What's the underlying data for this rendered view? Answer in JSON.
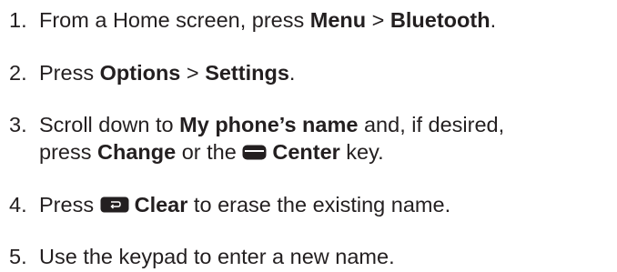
{
  "steps": [
    {
      "num": "1.",
      "t1": "From a Home screen, press ",
      "b1": "Menu",
      "t2": " > ",
      "b2": "Bluetooth",
      "t3": "."
    },
    {
      "num": "2.",
      "t1": "Press ",
      "b1": "Options",
      "t2": " > ",
      "b2": "Settings",
      "t3": "."
    },
    {
      "num": "3.",
      "t1": "Scroll down to ",
      "b1": "My phone’s name",
      "t2": " and, if desired,",
      "t3": "press ",
      "b2": "Change",
      "t4": " or the ",
      "icon": "center-key-icon",
      "b3": "Center",
      "t5": " key."
    },
    {
      "num": "4.",
      "t1": "Press ",
      "icon": "clear-key-icon",
      "b1": "Clear",
      "t2": " to erase the existing name."
    },
    {
      "num": "5.",
      "t1": "Use the keypad to enter a new name."
    }
  ]
}
